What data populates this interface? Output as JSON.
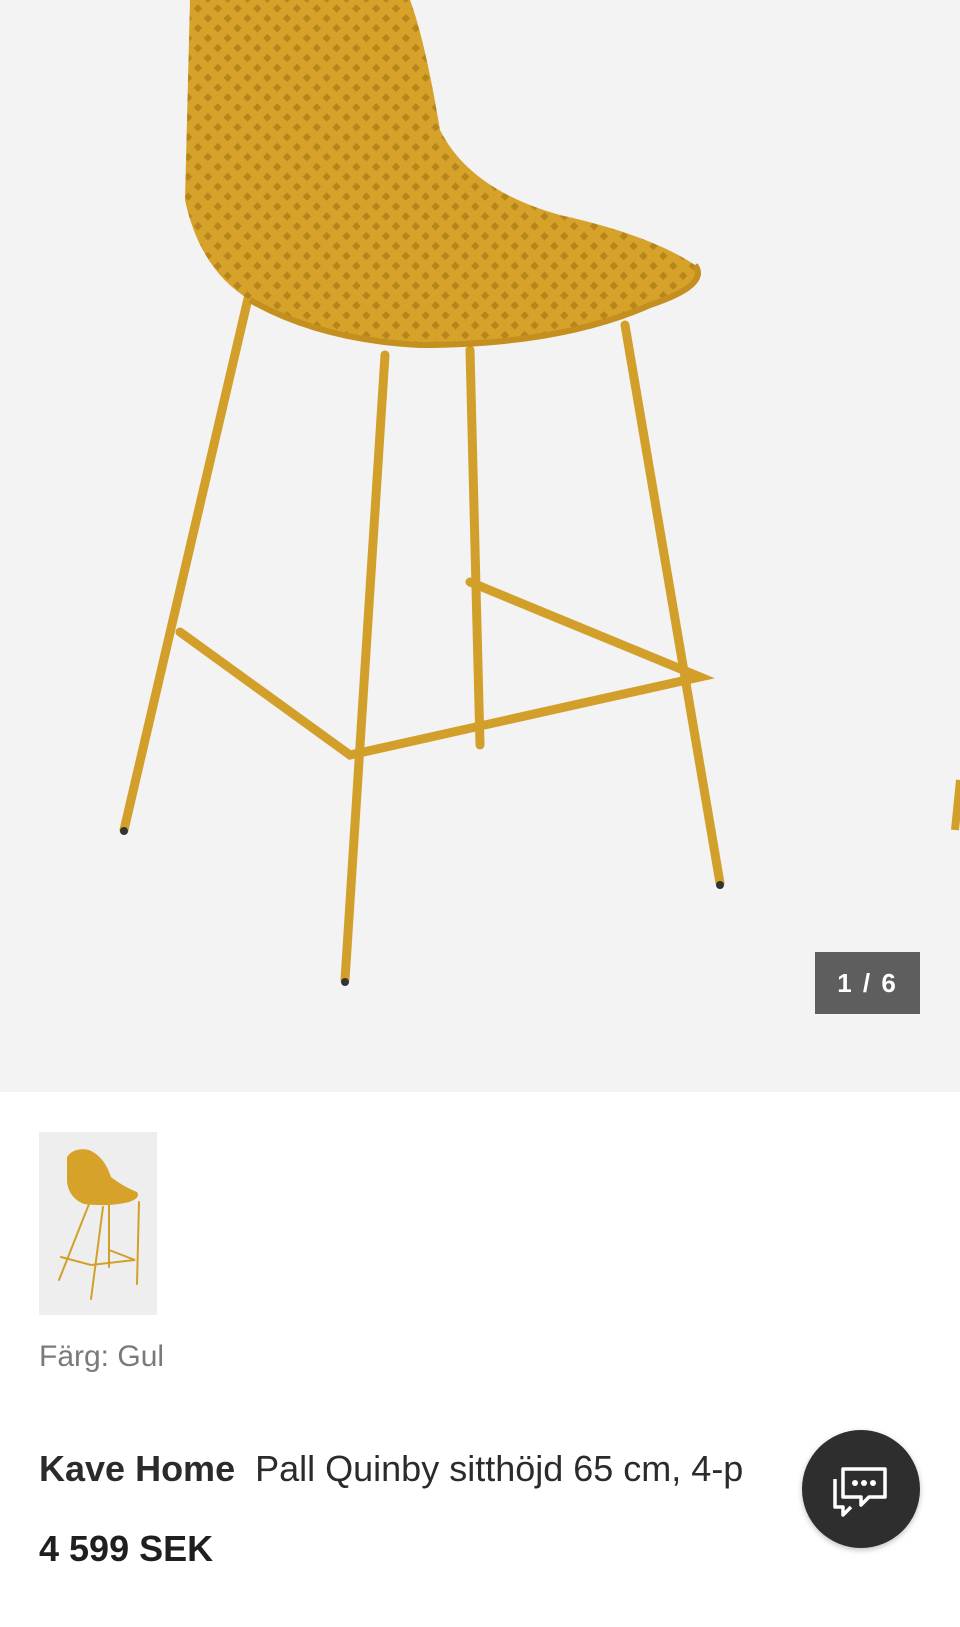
{
  "gallery": {
    "counter": "1 / 6",
    "current": 1,
    "total": 6,
    "product_color_hex": "#d9a52c"
  },
  "product": {
    "color_label": "Färg: Gul",
    "brand": "Kave Home",
    "name": "Pall Quinby sitthöjd 65 cm, 4-p",
    "price": "4 599 SEK"
  },
  "chat": {
    "icon": "chat-bubbles-icon"
  }
}
